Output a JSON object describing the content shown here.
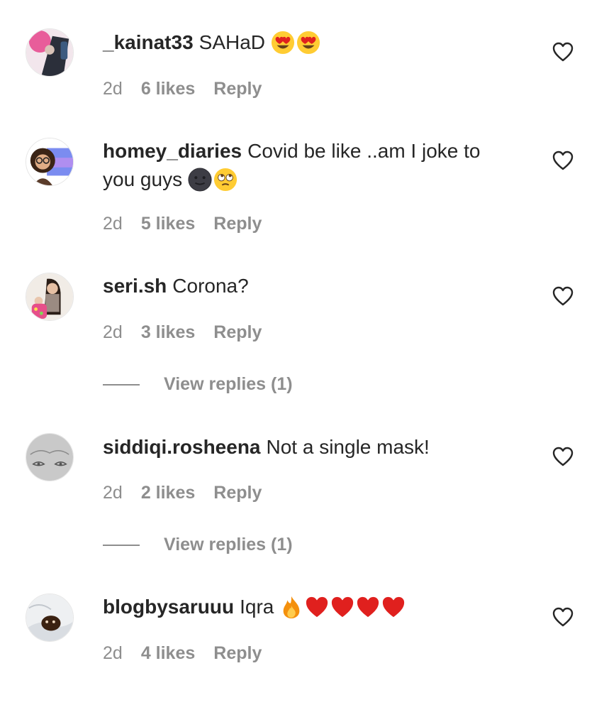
{
  "comments": [
    {
      "username": "_kainat33",
      "text_line1": "SAHaD",
      "text_line2": "",
      "emojis": [
        "heart-eyes-emoji",
        "heart-eyes-emoji"
      ],
      "age": "2d",
      "likes": "6 likes",
      "reply": "Reply",
      "view_replies": ""
    },
    {
      "username": "homey_diaries",
      "text_line1": "Covid be like ..am I joke to",
      "text_line2": "you guys",
      "emojis": [
        "dark-moon-face-emoji",
        "eye-roll-emoji"
      ],
      "age": "2d",
      "likes": "5 likes",
      "reply": "Reply",
      "view_replies": ""
    },
    {
      "username": "seri.sh",
      "text_line1": "Corona?",
      "text_line2": "",
      "emojis": [],
      "age": "2d",
      "likes": "3 likes",
      "reply": "Reply",
      "view_replies": "View replies (1)"
    },
    {
      "username": "siddiqi.rosheena",
      "text_line1": "Not a single mask!",
      "text_line2": "",
      "emojis": [],
      "age": "2d",
      "likes": "2 likes",
      "reply": "Reply",
      "view_replies": "View replies (1)"
    },
    {
      "username": "blogbysaruuu",
      "text_line1": "Iqra",
      "text_line2": "",
      "emojis": [
        "fire-emoji",
        "red-heart-emoji",
        "red-heart-emoji",
        "red-heart-emoji",
        "red-heart-emoji"
      ],
      "age": "2d",
      "likes": "4 likes",
      "reply": "Reply",
      "view_replies": ""
    }
  ],
  "icons": {
    "like": "heart-outline-icon"
  },
  "colors": {
    "text": "#262626",
    "secondary": "#8e8e8e",
    "emoji_heart": "#e0201e",
    "emoji_face": "#ffcc33"
  }
}
